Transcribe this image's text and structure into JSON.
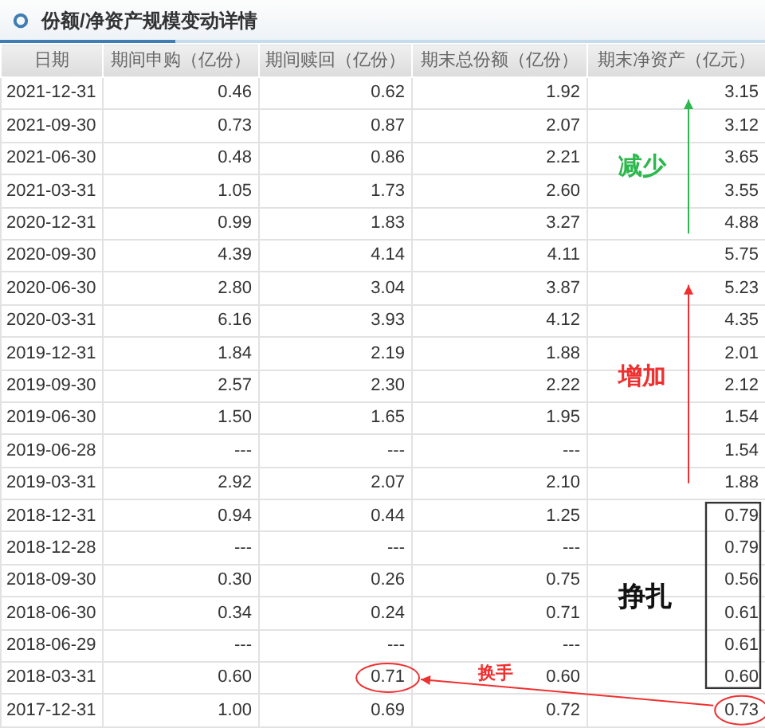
{
  "panel": {
    "title": "份额/净资产规模变动详情"
  },
  "table": {
    "columns": [
      "日期",
      "期间申购（亿份）",
      "期间赎回（亿份）",
      "期末总份额（亿份）",
      "期末净资产（亿元）"
    ],
    "rows": [
      [
        "2021-12-31",
        "0.46",
        "0.62",
        "1.92",
        "3.15"
      ],
      [
        "2021-09-30",
        "0.73",
        "0.87",
        "2.07",
        "3.12"
      ],
      [
        "2021-06-30",
        "0.48",
        "0.86",
        "2.21",
        "3.65"
      ],
      [
        "2021-03-31",
        "1.05",
        "1.73",
        "2.60",
        "3.55"
      ],
      [
        "2020-12-31",
        "0.99",
        "1.83",
        "3.27",
        "4.88"
      ],
      [
        "2020-09-30",
        "4.39",
        "4.14",
        "4.11",
        "5.75"
      ],
      [
        "2020-06-30",
        "2.80",
        "3.04",
        "3.87",
        "5.23"
      ],
      [
        "2020-03-31",
        "6.16",
        "3.93",
        "4.12",
        "4.35"
      ],
      [
        "2019-12-31",
        "1.84",
        "2.19",
        "1.88",
        "2.01"
      ],
      [
        "2019-09-30",
        "2.57",
        "2.30",
        "2.22",
        "2.12"
      ],
      [
        "2019-06-30",
        "1.50",
        "1.65",
        "1.95",
        "1.54"
      ],
      [
        "2019-06-28",
        "---",
        "---",
        "---",
        "1.54"
      ],
      [
        "2019-03-31",
        "2.92",
        "2.07",
        "2.10",
        "1.88"
      ],
      [
        "2018-12-31",
        "0.94",
        "0.44",
        "1.25",
        "0.79"
      ],
      [
        "2018-12-28",
        "---",
        "---",
        "---",
        "0.79"
      ],
      [
        "2018-09-30",
        "0.30",
        "0.26",
        "0.75",
        "0.56"
      ],
      [
        "2018-06-30",
        "0.34",
        "0.24",
        "0.71",
        "0.61"
      ],
      [
        "2018-06-29",
        "---",
        "---",
        "---",
        "0.61"
      ],
      [
        "2018-03-31",
        "0.60",
        "0.71",
        "0.60",
        "0.60"
      ],
      [
        "2017-12-31",
        "1.00",
        "0.69",
        "0.72",
        "0.73"
      ]
    ]
  },
  "annotations": [
    {
      "kind": "arrow",
      "label": "减少",
      "color": "#2db84d"
    },
    {
      "kind": "arrow",
      "label": "增加",
      "color": "#f03030"
    },
    {
      "kind": "frame",
      "label": "挣扎",
      "color": "#333333"
    },
    {
      "kind": "link",
      "label": "换手",
      "color": "#f03030"
    }
  ]
}
